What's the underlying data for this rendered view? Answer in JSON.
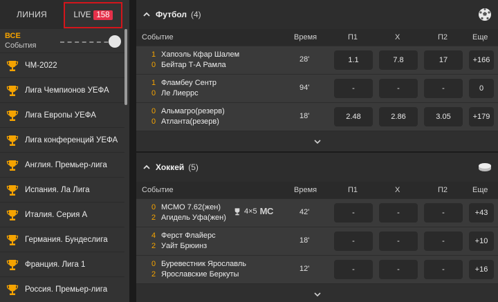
{
  "sidebar": {
    "tab_line": "ЛИНИЯ",
    "tab_live": "LIVE",
    "live_count": "158",
    "filter_all": "ВСЕ",
    "filter_events": "События",
    "items": [
      {
        "label": "ЧМ-2022"
      },
      {
        "label": "Лига Чемпионов УЕФА"
      },
      {
        "label": "Лига Европы УЕФА"
      },
      {
        "label": "Лига конференций УЕФА"
      },
      {
        "label": "Англия. Премьер-лига"
      },
      {
        "label": "Испания. Ла Лига"
      },
      {
        "label": "Италия. Серия А"
      },
      {
        "label": "Германия. Бундеслига"
      },
      {
        "label": "Франция. Лига 1"
      },
      {
        "label": "Россия. Премьер-лига"
      }
    ]
  },
  "columns": {
    "event": "Событие",
    "time": "Время",
    "p1": "П1",
    "x": "Х",
    "p2": "П2",
    "more": "Еще"
  },
  "football": {
    "title": "Футбол",
    "count": "(4)",
    "icon": "soccer-ball-icon",
    "rows": [
      {
        "score1": "1",
        "team1": "Хапоэль Кфар Шалем",
        "score2": "0",
        "team2": "Бейтар Т-А Рамла",
        "time": "28'",
        "p1": "1.1",
        "x": "7.8",
        "p2": "17",
        "more": "+166"
      },
      {
        "score1": "1",
        "team1": "Фламбеу Сентр",
        "score2": "0",
        "team2": "Ле Лиеррс",
        "time": "94'",
        "p1": "-",
        "x": "-",
        "p2": "-",
        "more": "0"
      },
      {
        "score1": "0",
        "team1": "Альмагро(резерв)",
        "score2": "0",
        "team2": "Атланта(резерв)",
        "time": "18'",
        "p1": "2.48",
        "x": "2.86",
        "p2": "3.05",
        "more": "+179"
      }
    ]
  },
  "hockey": {
    "title": "Хоккей",
    "count": "(5)",
    "icon": "hockey-puck-icon",
    "tournament_text": "4×5",
    "tournament_mc": "MC",
    "rows": [
      {
        "score1": "0",
        "team1": "МСМО 7.62(жен)",
        "score2": "2",
        "team2": "Агидель Уфа(жен)",
        "time": "42'",
        "p1": "-",
        "x": "-",
        "p2": "-",
        "more": "+43"
      },
      {
        "score1": "4",
        "team1": "Ферст Флайерс",
        "score2": "2",
        "team2": "Уайт Брюинз",
        "time": "18'",
        "p1": "-",
        "x": "-",
        "p2": "-",
        "more": "+10"
      },
      {
        "score1": "0",
        "team1": "Буревестник Ярославль",
        "score2": "2",
        "team2": "Ярославские Беркуты",
        "time": "12'",
        "p1": "-",
        "x": "-",
        "p2": "-",
        "more": "+16"
      }
    ]
  },
  "colors": {
    "accent": "#f5a300",
    "live_badge": "#e6314a",
    "highlight_border": "#d4151b"
  }
}
